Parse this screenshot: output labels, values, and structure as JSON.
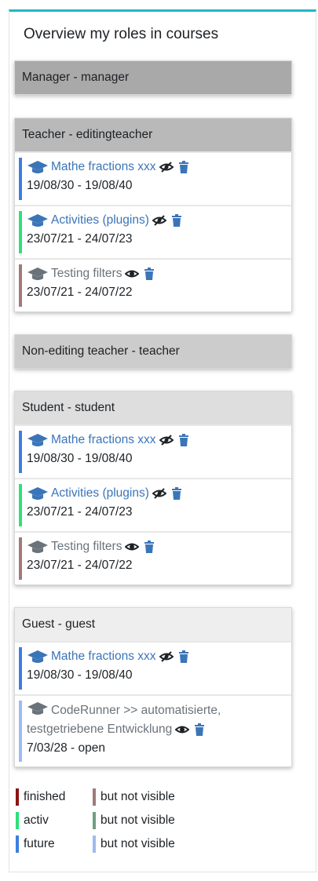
{
  "block": {
    "title": "Overview my roles in courses"
  },
  "roles": [
    {
      "label": "Manager - manager",
      "header_color": "#a9a9a9",
      "courses": []
    },
    {
      "label": "Teacher - editingteacher",
      "header_color": "#b9b9b9",
      "courses": [
        {
          "title": "Mathe fractions xxx",
          "dates": "19/08/30 - 19/08/40",
          "status_color": "#3c7fe0",
          "visible": false,
          "title_style": "link"
        },
        {
          "title": "Activities (plugins)",
          "dates": "23/07/21 - 24/07/23",
          "status_color": "#2ee07a",
          "visible": false,
          "title_style": "link"
        },
        {
          "title": "Testing filters",
          "dates": "23/07/21 - 24/07/22",
          "status_color": "#a07a78",
          "visible": true,
          "title_style": "grey"
        }
      ]
    },
    {
      "label": "Non-editing teacher - teacher",
      "header_color": "#cccccc",
      "courses": []
    },
    {
      "label": "Student - student",
      "header_color": "#dedede",
      "courses": [
        {
          "title": "Mathe fractions xxx",
          "dates": "19/08/30 - 19/08/40",
          "status_color": "#3c7fe0",
          "visible": false,
          "title_style": "link"
        },
        {
          "title": "Activities (plugins)",
          "dates": "23/07/21 - 24/07/23",
          "status_color": "#2ee07a",
          "visible": false,
          "title_style": "link"
        },
        {
          "title": "Testing filters",
          "dates": "23/07/21 - 24/07/22",
          "status_color": "#a07a78",
          "visible": true,
          "title_style": "grey"
        }
      ]
    },
    {
      "label": "Guest - guest",
      "header_color": "#eeeeee",
      "courses": [
        {
          "title": "Mathe fractions xxx",
          "dates": "19/08/30 - 19/08/40",
          "status_color": "#3c7fe0",
          "visible": false,
          "title_style": "link"
        },
        {
          "title": "CodeRunner >> automatisierte, testgetriebene Entwicklung",
          "dates": "7/03/28 - open",
          "status_color": "#9dbbef",
          "visible": true,
          "title_style": "grey"
        }
      ]
    }
  ],
  "legend": [
    {
      "label": "finished",
      "color": "#8b1414"
    },
    {
      "label": "but not visible",
      "color": "#a07a78"
    },
    {
      "label": "activ",
      "color": "#2ee07a"
    },
    {
      "label": "but not visible",
      "color": "#6fa080"
    },
    {
      "label": "future",
      "color": "#3c7fe0"
    },
    {
      "label": "but not visible",
      "color": "#9dbbef"
    }
  ],
  "icons": {
    "course": "graduation-cap-icon",
    "hidden": "eye-slash-icon",
    "visible": "eye-icon",
    "delete": "trash-icon"
  },
  "colors": {
    "accent": "#1fb9c3",
    "link": "#3a75b8",
    "grey_title": "#6a737b"
  }
}
